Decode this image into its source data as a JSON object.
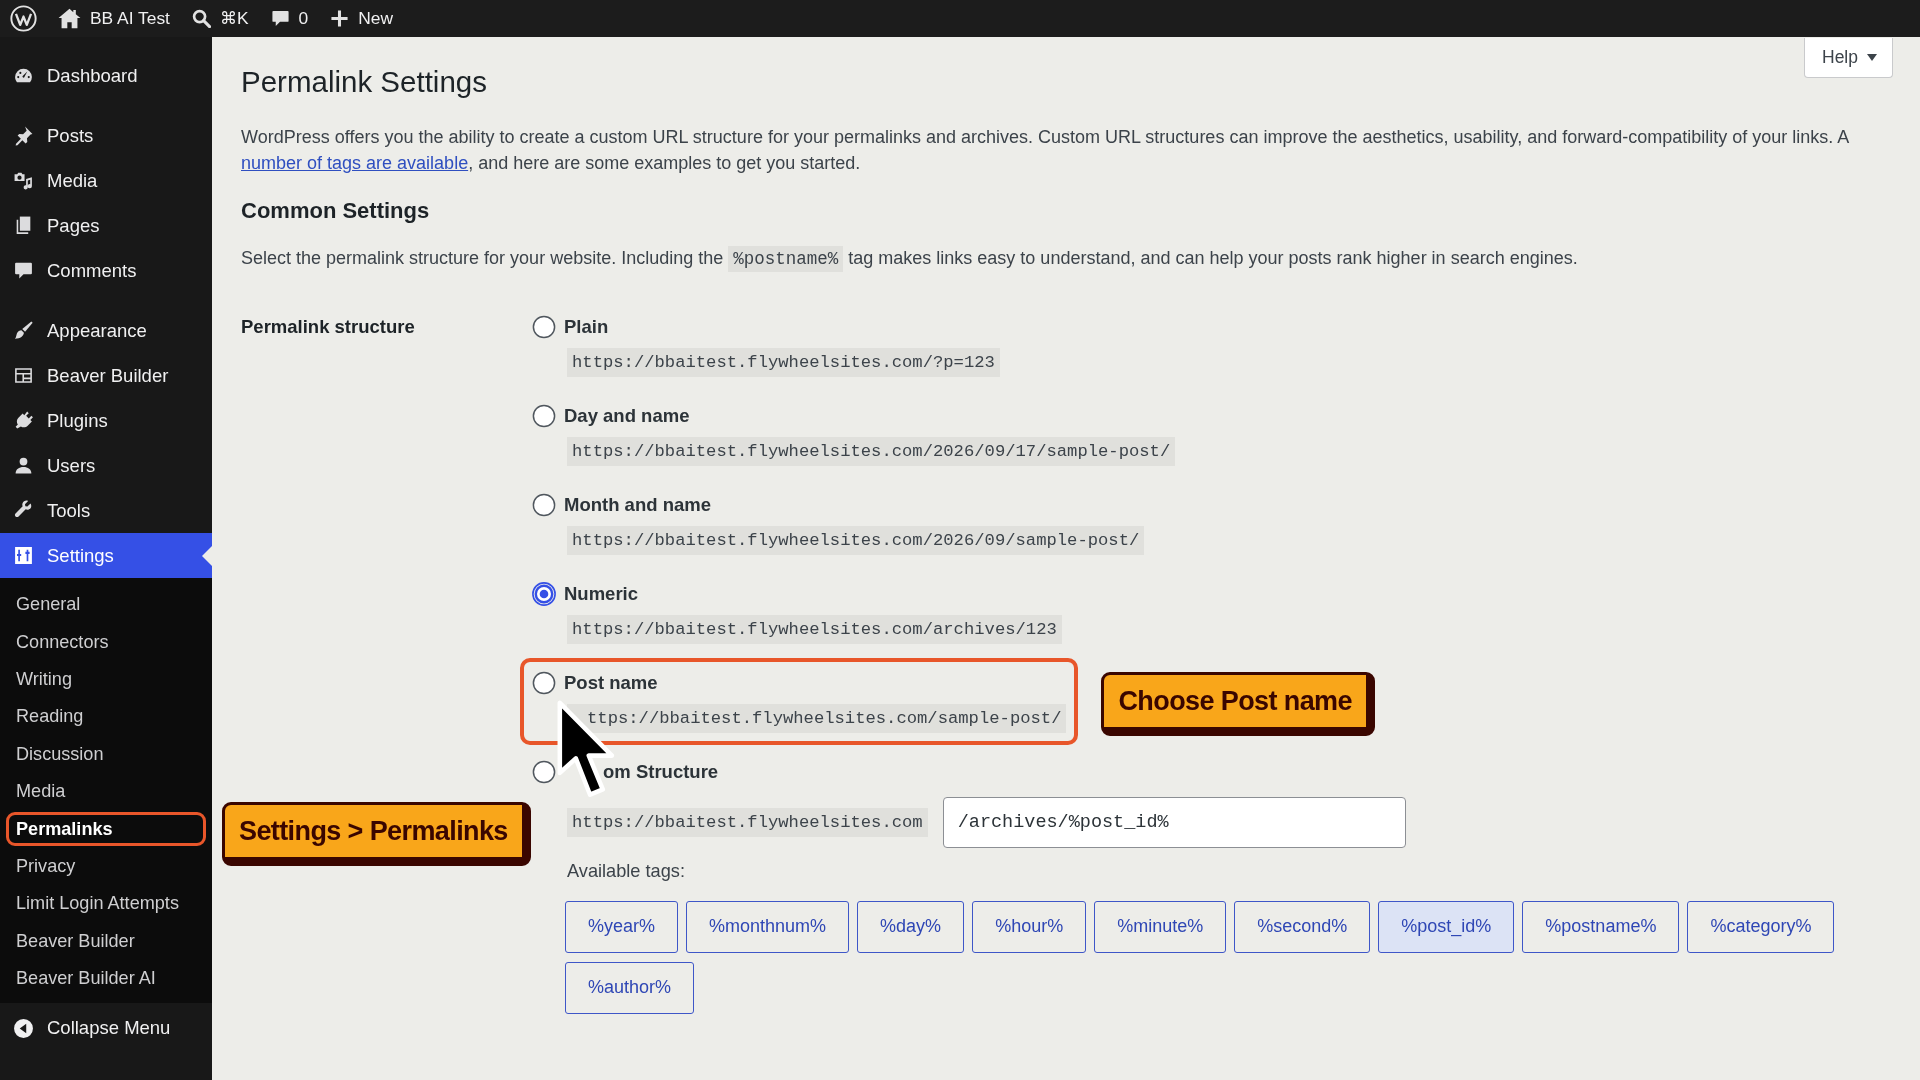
{
  "admin_bar": {
    "site_name": "BB AI Test",
    "search_shortcut": "⌘K",
    "comment_count": "0",
    "new_label": "New"
  },
  "sidebar": {
    "menu_groups": [
      [
        {
          "label": "Dashboard",
          "selected": false
        }
      ],
      [
        {
          "label": "Posts",
          "selected": false
        },
        {
          "label": "Media",
          "selected": false
        },
        {
          "label": "Pages",
          "selected": false
        },
        {
          "label": "Comments",
          "selected": false
        }
      ],
      [
        {
          "label": "Appearance",
          "selected": false
        },
        {
          "label": "Beaver Builder",
          "selected": false
        },
        {
          "label": "Plugins",
          "selected": false
        },
        {
          "label": "Users",
          "selected": false
        },
        {
          "label": "Tools",
          "selected": false
        },
        {
          "label": "Settings",
          "selected": true,
          "submenu": [
            {
              "label": "General",
              "selected": false,
              "highlighted": false
            },
            {
              "label": "Connectors",
              "selected": false,
              "highlighted": false
            },
            {
              "label": "Writing",
              "selected": false,
              "highlighted": false
            },
            {
              "label": "Reading",
              "selected": false,
              "highlighted": false
            },
            {
              "label": "Discussion",
              "selected": false,
              "highlighted": false
            },
            {
              "label": "Media",
              "selected": false,
              "highlighted": false
            },
            {
              "label": "Permalinks",
              "selected": true,
              "highlighted": true,
              "callout": "Settings > Permalinks"
            },
            {
              "label": "Privacy",
              "selected": false,
              "highlighted": false
            },
            {
              "label": "Limit Login Attempts",
              "selected": false,
              "highlighted": false
            },
            {
              "label": "Beaver Builder",
              "selected": false,
              "highlighted": false
            },
            {
              "label": "Beaver Builder AI",
              "selected": false,
              "highlighted": false
            }
          ]
        }
      ]
    ],
    "collapse_label": "Collapse Menu"
  },
  "page": {
    "help_label": "Help",
    "title": "Permalink Settings",
    "intro": {
      "before": "WordPress offers you the ability to create a custom URL structure for your permalinks and archives. Custom URL structures can improve the aesthetics, usability, and forward-compatibility of your links. A",
      "link": "number of tags are available",
      "after": ", and here are some examples to get you started."
    },
    "common_heading": "Common Settings",
    "common_text": {
      "before": "Select the permalink structure for your website. Including the",
      "code": "%postname%",
      "after": "tag makes links easy to understand, and can help your posts rank higher in search engines."
    },
    "structure_label": "Permalink structure",
    "options": [
      {
        "kind": "preset",
        "label": "Plain",
        "example": "https://bbaitest.flywheelsites.com/?p=123",
        "selected": false,
        "highlighted": false,
        "pointer": false
      },
      {
        "kind": "preset",
        "label": "Day and name",
        "example": "https://bbaitest.flywheelsites.com/2026/09/17/sample-post/",
        "selected": false,
        "highlighted": false,
        "pointer": false
      },
      {
        "kind": "preset",
        "label": "Month and name",
        "example": "https://bbaitest.flywheelsites.com/2026/09/sample-post/",
        "selected": false,
        "highlighted": false,
        "pointer": false
      },
      {
        "kind": "preset",
        "label": "Numeric",
        "example": "https://bbaitest.flywheelsites.com/archives/123",
        "selected": true,
        "highlighted": false,
        "pointer": false
      },
      {
        "kind": "preset",
        "label": "Post name",
        "example": "ttps://bbaitest.flywheelsites.com/sample-post/",
        "selected": false,
        "highlighted": true,
        "pointer": true,
        "callout": "Choose Post name"
      },
      {
        "kind": "custom",
        "label": "om Structure",
        "prefix": "https://bbaitest.flywheelsites.com",
        "value": "/archives/%post_id%",
        "selected": false,
        "highlighted": false,
        "pointer": false,
        "tags_label": "Available tags:",
        "tags": [
          {
            "label": "%year%",
            "selected": false
          },
          {
            "label": "%monthnum%",
            "selected": false
          },
          {
            "label": "%day%",
            "selected": false
          },
          {
            "label": "%hour%",
            "selected": false
          },
          {
            "label": "%minute%",
            "selected": false
          },
          {
            "label": "%second%",
            "selected": false
          },
          {
            "label": "%post_id%",
            "selected": true
          },
          {
            "label": "%postname%",
            "selected": false
          },
          {
            "label": "%category%",
            "selected": false
          },
          {
            "label": "%author%",
            "selected": false
          }
        ]
      }
    ]
  }
}
